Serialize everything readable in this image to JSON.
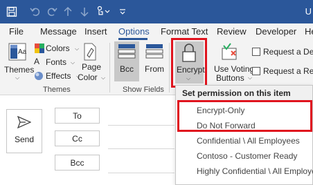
{
  "titlebar": {
    "title_text": "U"
  },
  "tabs": [
    "File",
    "Message",
    "Insert",
    "Options",
    "Format Text",
    "Review",
    "Developer",
    "Help"
  ],
  "ribbon": {
    "themes_label": "Themes",
    "colors_label": "Colors",
    "fonts_label": "Fonts",
    "effects_label": "Effects",
    "page_color_line1": "Page",
    "page_color_line2": "Color",
    "themes_group_label": "Themes",
    "bcc_label": "Bcc",
    "from_label": "From",
    "show_fields_group_label": "Show Fields",
    "encrypt_label": "Encrypt",
    "voting_line1": "Use Voting",
    "voting_line2": "Buttons",
    "request_delivery_label": "Request a Delive",
    "request_read_label": "Request a Read"
  },
  "compose": {
    "send_label": "Send",
    "to_label": "To",
    "cc_label": "Cc",
    "bcc_label": "Bcc"
  },
  "menu": {
    "header": "Set permission on this item",
    "items": [
      "Encrypt-Only",
      "Do Not Forward",
      "Confidential \\ All Employees",
      "Contoso - Customer Ready",
      "Highly Confidential \\ All Employees"
    ]
  },
  "colors": {
    "titlebar": "#2b579a",
    "ribbon_bg": "#f3f3f3",
    "active_tab": "#2b579a",
    "highlight_box": "#e0141e"
  },
  "icons": [
    "save-icon",
    "undo-icon",
    "redo-icon",
    "up-arrow-icon",
    "down-arrow-icon",
    "touch-mode-icon",
    "customize-quick-access-icon",
    "themes-icon",
    "colors-icon",
    "fonts-icon",
    "effects-icon",
    "page-color-icon",
    "bcc-icon",
    "from-icon",
    "lock-icon",
    "voting-icon",
    "send-icon"
  ]
}
